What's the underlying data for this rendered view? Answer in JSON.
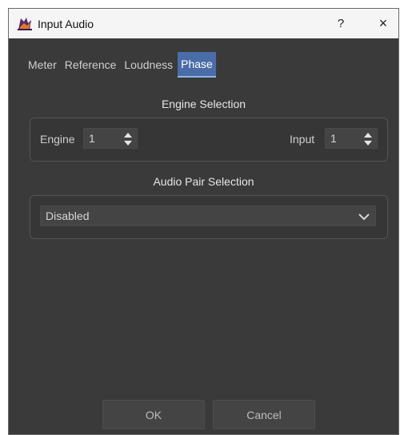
{
  "window": {
    "title": "Input Audio",
    "help_label": "?",
    "close_label": "×"
  },
  "tabs": [
    {
      "label": "Meter",
      "active": false
    },
    {
      "label": "Reference",
      "active": false
    },
    {
      "label": "Loudness",
      "active": false
    },
    {
      "label": "Phase",
      "active": true
    }
  ],
  "engine_selection": {
    "title": "Engine Selection",
    "engine": {
      "label": "Engine",
      "value": "1"
    },
    "input": {
      "label": "Input",
      "value": "1"
    }
  },
  "audio_pair_selection": {
    "title": "Audio Pair Selection",
    "selected": "Disabled"
  },
  "buttons": {
    "ok": "OK",
    "cancel": "Cancel"
  },
  "colors": {
    "accent": "#4a6da8",
    "dialog_bg": "#3a3a3a"
  }
}
